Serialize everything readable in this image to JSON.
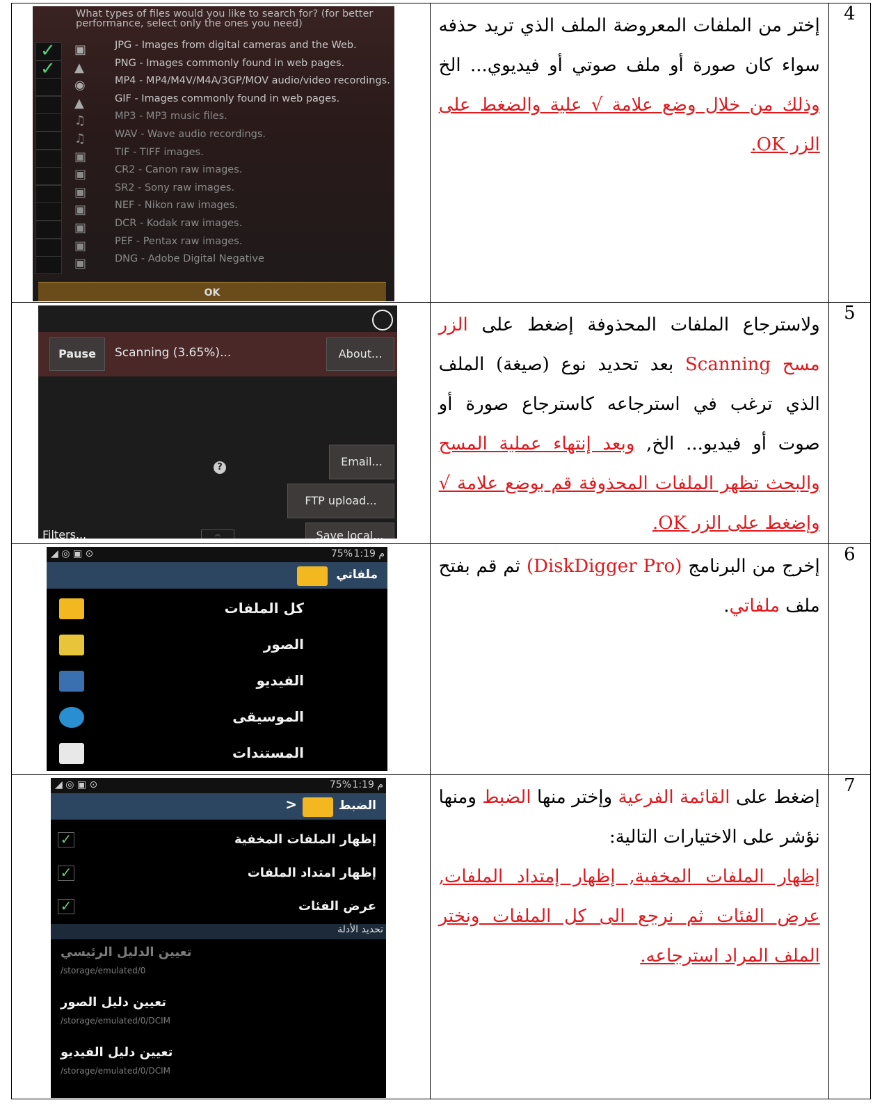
{
  "rows": [
    {
      "number": "4",
      "text_plain": "إختر من الملفات المعروضة الملف الذي تريد حذفه سواء كان صورة أو ملف صوتي أو فيديوي... الخ",
      "text_red_underlined": " وذلك من خلال وضع علامة √ علية والضغط على الزر OK."
    },
    {
      "number": "5",
      "text_a": "ولاسترجاع الملفات المحذوفة إضغط على ",
      "text_red_a": "الزر مسح Scanning",
      "text_b": " بعد تحديد نوع (صيغة) الملف الذي ترغب في استرجاعه كاسترجاع صورة أو صوت أو فيديو... الخ, ",
      "text_red_underlined": "وبعد إنتهاء عملية المسح والبحث تظهر الملفات المحذوفة قم بوضع علامة √ وإضغط على الزر OK."
    },
    {
      "number": "6",
      "text_a": "إخرج من البرنامج ",
      "text_red_a": "(DiskDigger Pro)",
      "text_b": " ثم قم بفتح ملف ",
      "text_red_b": "ملفاتي",
      "text_c": "."
    },
    {
      "number": "7",
      "text_a": "إضغط على ",
      "text_red_a": "القائمة الفرعية",
      "text_b": " وإختر منها ",
      "text_red_b": "الضبط",
      "text_c": " ومنها نؤشر على الاختيارات التالية:",
      "text_red_underlined": "إظهار الملفات المخفية, إظهار إمتداد الملفات, عرض الفئات ثم نرجع الى كل الملفات ونختر الملف المراد استرجاعه."
    }
  ],
  "screen1": {
    "header": "What types of files would you like to search for? (for better performance, select only the ones you need)",
    "file_types": [
      {
        "label": "JPG - Images from digital cameras and the Web.",
        "checked": true
      },
      {
        "label": "PNG - Images commonly found in web pages.",
        "checked": true
      },
      {
        "label": "MP4 - MP4/M4V/M4A/3GP/MOV audio/video recordings.",
        "checked": false
      },
      {
        "label": "GIF - Images commonly found in web pages.",
        "checked": false
      },
      {
        "label": "MP3 - MP3 music files.",
        "checked": false
      },
      {
        "label": "WAV - Wave audio recordings.",
        "checked": false
      },
      {
        "label": "TIF - TIFF images.",
        "checked": false
      },
      {
        "label": "CR2 - Canon raw images.",
        "checked": false
      },
      {
        "label": "SR2 - Sony raw images.",
        "checked": false
      },
      {
        "label": "NEF - Nikon raw images.",
        "checked": false
      },
      {
        "label": "DCR - Kodak raw images.",
        "checked": false
      },
      {
        "label": "PEF - Pentax raw images.",
        "checked": false
      },
      {
        "label": "DNG - Adobe Digital Negative",
        "checked": false
      }
    ],
    "ok_label": "OK"
  },
  "screen2": {
    "pause_label": "Pause",
    "status": "Scanning (3.65%)...",
    "progress_percent": 3.65,
    "about_label": "About...",
    "email_label": "Email...",
    "ftp_label": "FTP upload...",
    "filters_label": "Filters...",
    "save_label": "Save local..."
  },
  "screen3": {
    "status_time": "1:19 م",
    "battery": "75%",
    "title": "ملفاتي",
    "items": [
      "كل الملفات",
      "الصور",
      "الفيديو",
      "الموسيقى",
      "المستندات"
    ]
  },
  "screen4": {
    "status_time": "1:19 م",
    "battery": "75%",
    "title": "الضبط",
    "options": [
      {
        "label": "إظهار الملفات المخفية",
        "checked": true
      },
      {
        "label": "إظهار امتداد الملفات",
        "checked": true
      },
      {
        "label": "عرض الفئات",
        "checked": true
      }
    ],
    "section": "تحديد الأدلة",
    "dirs": [
      {
        "label": "تعيين الدليل الرئيسي",
        "path": "/storage/emulated/0"
      },
      {
        "label": "تعيين دليل الصور",
        "path": "/storage/emulated/0/DCIM"
      },
      {
        "label": "تعيين دليل الفيديو",
        "path": "/storage/emulated/0/DCIM"
      }
    ]
  }
}
